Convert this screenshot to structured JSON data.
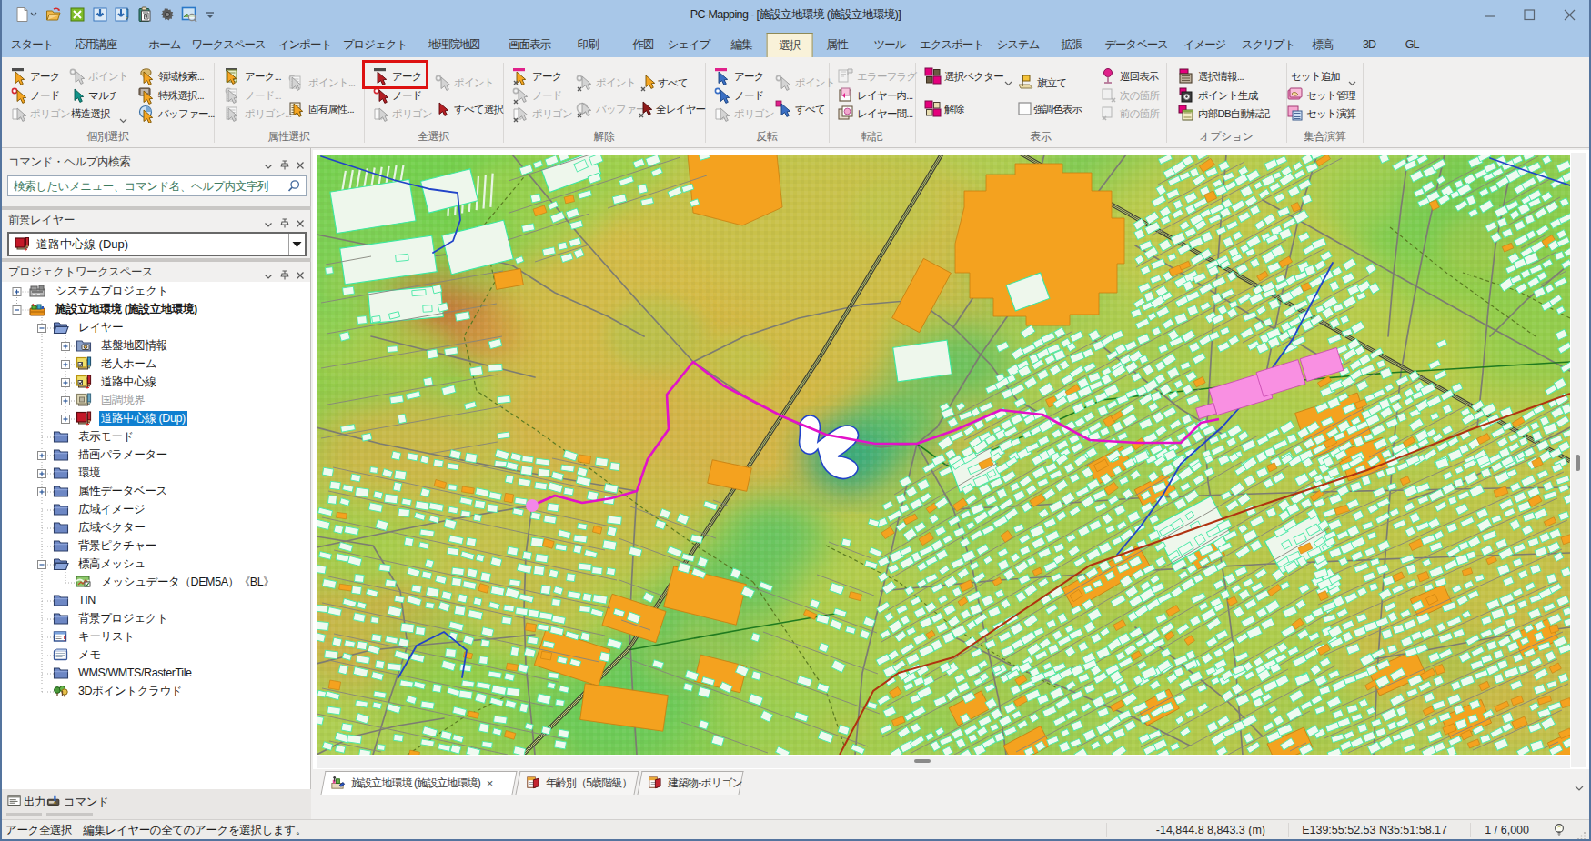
{
  "window": {
    "title": "PC-Mapping - [施設立地環境 (施設立地環境)]",
    "qat": [
      "new-document-icon",
      "open-folder-icon",
      "close-x-green-icon",
      "import-box-icon",
      "import-edit-icon",
      "paste-clipboard-icon",
      "gear-icon",
      "image-search-icon",
      "qat-more-icon"
    ]
  },
  "ribbon": {
    "tabs": [
      {
        "label": "スタート"
      },
      {
        "label": "応用講座"
      },
      {
        "label": "ホーム"
      },
      {
        "label": "ワークスペース"
      },
      {
        "label": "インポート"
      },
      {
        "label": "プロジェクト"
      },
      {
        "label": "地理院地図"
      },
      {
        "label": "画面表示"
      },
      {
        "label": "印刷"
      },
      {
        "label": "作図"
      },
      {
        "label": "シェイプ"
      },
      {
        "label": "編集"
      },
      {
        "label": "選択",
        "active": true
      },
      {
        "label": "属性"
      },
      {
        "label": "ツール"
      },
      {
        "label": "エクスポート"
      },
      {
        "label": "システム"
      },
      {
        "label": "拡張"
      },
      {
        "label": "データベース"
      },
      {
        "label": "イメージ"
      },
      {
        "label": "スクリプト"
      },
      {
        "label": "標高"
      },
      {
        "label": "3D"
      },
      {
        "label": "GL"
      }
    ],
    "groups": [
      {
        "label": "個別選択",
        "buttons": [
          {
            "label": "アーク",
            "icon": "cur-yellow-bar",
            "en": 1
          },
          {
            "label": "ノード",
            "icon": "cur-yellow-ring",
            "en": 1
          },
          {
            "label": "ポリゴン",
            "icon": "cur-gray-page",
            "en": 0
          },
          {
            "label": "ポイント",
            "icon": "cur-gray-ring",
            "en": 0
          },
          {
            "label": "マルチ",
            "icon": "cur-teal",
            "en": 1
          },
          {
            "label": "構造選択",
            "icon": "",
            "en": 1
          },
          {
            "label": "領域検索...",
            "icon": "region-search",
            "en": 1
          },
          {
            "label": "特殊選択...",
            "icon": "special-select",
            "en": 1
          },
          {
            "label": "バッファー...",
            "icon": "buffer-select",
            "en": 1
          }
        ]
      },
      {
        "label": "属性選択",
        "buttons": [
          {
            "label": "アーク...",
            "icon": "tbl-yellow-bar",
            "en": 1
          },
          {
            "label": "ノード...",
            "icon": "tbl-gray-ring",
            "en": 0
          },
          {
            "label": "ポリゴン...",
            "icon": "tbl-gray-page",
            "en": 0
          },
          {
            "label": "ポイント...",
            "icon": "tbl-gray-ring2",
            "en": 0
          },
          {
            "label": "固有属性...",
            "icon": "tbl-attr",
            "en": 1
          }
        ]
      },
      {
        "label": "全選択",
        "buttons": [
          {
            "label": "アーク",
            "icon": "cur-red-bar",
            "en": 1
          },
          {
            "label": "ノード",
            "icon": "cur-red-ring",
            "en": 1
          },
          {
            "label": "ポリゴン",
            "icon": "cur-gray-page",
            "en": 0
          },
          {
            "label": "ポイント",
            "icon": "cur-gray-ring",
            "en": 0
          },
          {
            "label": "すべて選択",
            "icon": "cur-red",
            "en": 1
          }
        ]
      },
      {
        "label": "解除",
        "buttons": [
          {
            "label": "アーク",
            "icon": "cur-yellow-mbar-x",
            "en": 1
          },
          {
            "label": "ノード",
            "icon": "cur-gray-ring-x",
            "en": 0
          },
          {
            "label": "ポリゴン",
            "icon": "cur-gray-page-x",
            "en": 0
          },
          {
            "label": "ポイント",
            "icon": "cur-gray-ring-x",
            "en": 0
          },
          {
            "label": "バッファー",
            "icon": "cur-gray-buf-x",
            "en": 0
          },
          {
            "label": "すべて",
            "icon": "cur-yellow-x",
            "en": 1
          },
          {
            "label": "全レイヤー",
            "icon": "cur-darkred-x",
            "en": 1
          }
        ]
      },
      {
        "label": "反転",
        "buttons": [
          {
            "label": "アーク",
            "icon": "cur-blue-mbar",
            "en": 1
          },
          {
            "label": "ノード",
            "icon": "cur-blue-ring",
            "en": 1
          },
          {
            "label": "ポリゴン",
            "icon": "cur-gray-page",
            "en": 0
          },
          {
            "label": "ポイント",
            "icon": "cur-gray-ring",
            "en": 0
          },
          {
            "label": "すべて",
            "icon": "cur-blue-sq",
            "en": 1
          }
        ]
      },
      {
        "label": "転記",
        "buttons": [
          {
            "label": "エラーフラグ",
            "icon": "errorflag",
            "en": 0
          },
          {
            "label": "レイヤー内...",
            "icon": "layer-in",
            "en": 1
          },
          {
            "label": "レイヤー間...",
            "icon": "layer-between",
            "en": 1
          }
        ]
      },
      {
        "label": "表示",
        "buttons": [
          {
            "label": "選択ベクター",
            "icon": "sel-vector",
            "en": 1
          },
          {
            "label": "解除",
            "icon": "sel-clear",
            "en": 1
          },
          {
            "label": "旗立て",
            "icon": "flag-set",
            "en": 1
          },
          {
            "label": "強調色表示",
            "icon": "checkbox",
            "en": 1
          },
          {
            "label": "巡回表示",
            "icon": "tour-pin",
            "en": 1
          },
          {
            "label": "次の箇所",
            "icon": "next-place",
            "en": 0
          },
          {
            "label": "前の箇所",
            "icon": "prev-place",
            "en": 0
          }
        ]
      },
      {
        "label": "オプション",
        "buttons": [
          {
            "label": "選択情報...",
            "icon": "sel-info",
            "en": 1
          },
          {
            "label": "ポイント生成",
            "icon": "point-gen",
            "en": 1
          },
          {
            "label": "内部DB自動転記",
            "icon": "db-auto",
            "en": 1
          }
        ]
      },
      {
        "label": "集合演算",
        "buttons": [
          {
            "label": "セット追加",
            "icon": "",
            "en": 1
          },
          {
            "label": "セット管理",
            "icon": "set-manage",
            "en": 1
          },
          {
            "label": "セット演算",
            "icon": "set-calc",
            "en": 1
          }
        ]
      }
    ]
  },
  "panels": {
    "search": {
      "title": "コマンド・ヘルプ内検索",
      "placeholder": "検索したいメニュー、コマンド名、ヘルプ内文字列"
    },
    "layer": {
      "title": "前景レイヤー",
      "value": "道路中心線 (Dup)"
    },
    "workspace": {
      "title": "プロジェクトワークスペース"
    }
  },
  "tree": [
    {
      "label": "システムプロジェクト",
      "lvl": 0,
      "exp": "+",
      "icon": "sysproj"
    },
    {
      "label": "施設立地環境 (施設立地環境)",
      "lvl": 0,
      "exp": "-",
      "icon": "project",
      "bold": 1
    },
    {
      "label": "レイヤー",
      "lvl": 1,
      "exp": "-",
      "icon": "folder-open"
    },
    {
      "label": "基盤地図情報",
      "lvl": 2,
      "exp": "+",
      "icon": "folder-cam"
    },
    {
      "label": "老人ホーム",
      "lvl": 2,
      "exp": "+",
      "icon": "layer-yellow-bluepen"
    },
    {
      "label": "道路中心線",
      "lvl": 2,
      "exp": "+",
      "icon": "layer-yellow-redpen"
    },
    {
      "label": "国調境界",
      "lvl": 2,
      "exp": "+",
      "icon": "layer-gray-bluepen",
      "dis": 1
    },
    {
      "label": "道路中心線 (Dup)",
      "lvl": 2,
      "exp": "+",
      "icon": "layer-red-redpen",
      "sel": 1
    },
    {
      "label": "表示モード",
      "lvl": 1,
      "exp": "",
      "icon": "folder"
    },
    {
      "label": "描画パラメーター",
      "lvl": 1,
      "exp": "+",
      "icon": "folder"
    },
    {
      "label": "環境",
      "lvl": 1,
      "exp": "+",
      "icon": "folder"
    },
    {
      "label": "属性データベース",
      "lvl": 1,
      "exp": "+",
      "icon": "folder"
    },
    {
      "label": "広域イメージ",
      "lvl": 1,
      "exp": "",
      "icon": "folder"
    },
    {
      "label": "広域ベクター",
      "lvl": 1,
      "exp": "",
      "icon": "folder"
    },
    {
      "label": "背景ピクチャー",
      "lvl": 1,
      "exp": "",
      "icon": "folder"
    },
    {
      "label": "標高メッシュ",
      "lvl": 1,
      "exp": "-",
      "icon": "folder-open"
    },
    {
      "label": "メッシュデータ（DEM5A）《BL》",
      "lvl": 2,
      "exp": "",
      "icon": "mesh"
    },
    {
      "label": "TIN",
      "lvl": 1,
      "exp": "",
      "icon": "folder"
    },
    {
      "label": "背景プロジェクト",
      "lvl": 1,
      "exp": "",
      "icon": "folder"
    },
    {
      "label": "キーリスト",
      "lvl": 1,
      "exp": "",
      "icon": "keylist"
    },
    {
      "label": "メモ",
      "lvl": 1,
      "exp": "",
      "icon": "memo"
    },
    {
      "label": "WMS/WMTS/RasterTile",
      "lvl": 1,
      "exp": "",
      "icon": "folder"
    },
    {
      "label": "3Dポイントクラウド",
      "lvl": 1,
      "exp": "",
      "icon": "cloud3d"
    }
  ],
  "output_tabs": [
    {
      "label": "出力",
      "icon": "output-icon"
    },
    {
      "label": "コマンド",
      "icon": "command-icon"
    }
  ],
  "doc_tabs": [
    {
      "label": "施設立地環境 (施設立地環境)",
      "icon": "doc-project-icon",
      "active": 1,
      "close": "×"
    },
    {
      "label": "年齢別（5歳階級）",
      "icon": "doc-book-icon"
    },
    {
      "label": "建築物-ポリゴン",
      "icon": "doc-book-icon"
    }
  ],
  "status": {
    "message": "アーク全選択　編集レイヤーの全てのアークを選択します。",
    "coords": "-14,844.8 8,843.3 (m)",
    "latlon": "E139:55:52.53 N35:51:58.17",
    "scale": "1 / 6,000"
  },
  "annotation": {
    "color": "#e01010",
    "target": "全選択-アーク"
  }
}
